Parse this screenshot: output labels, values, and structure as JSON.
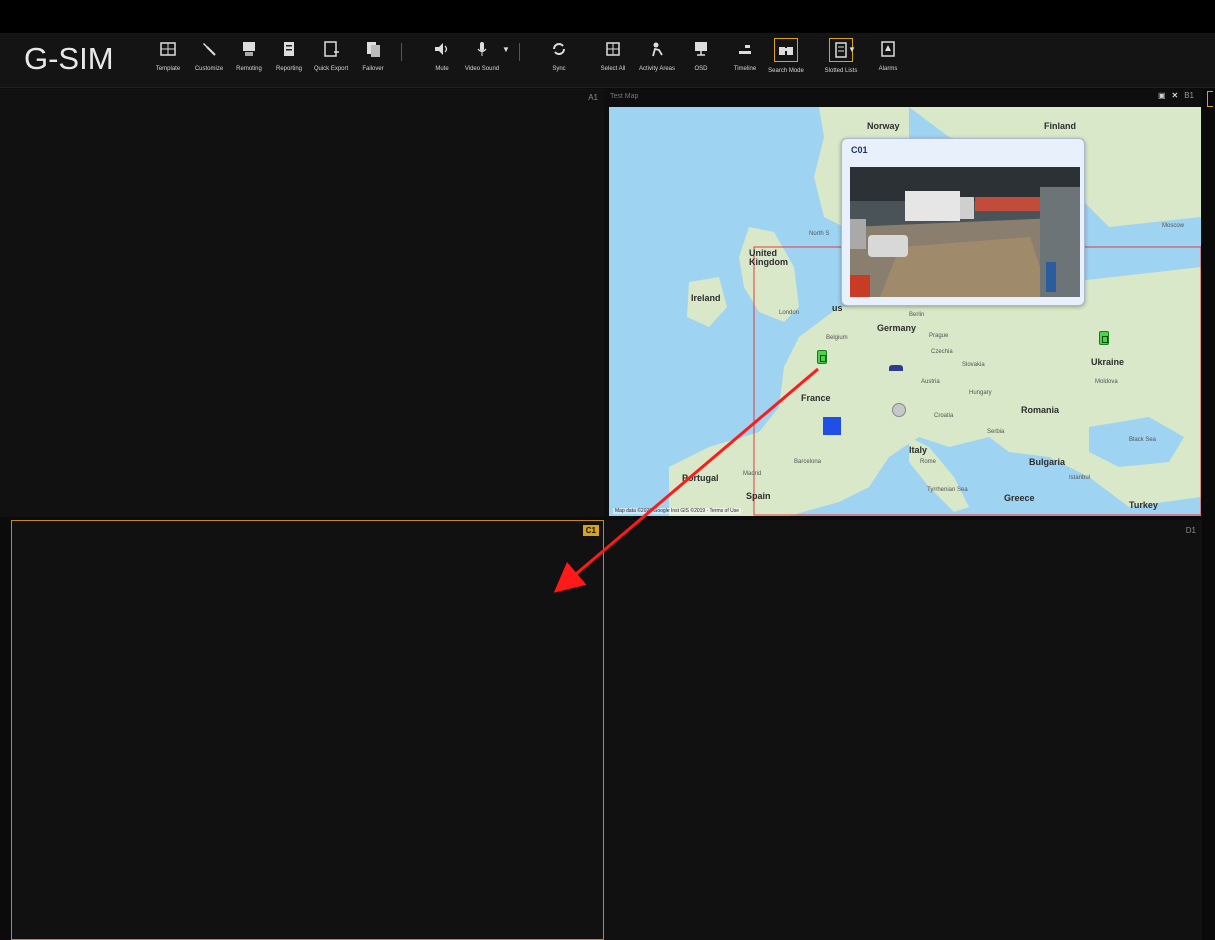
{
  "app": {
    "logo": "G-SIM"
  },
  "toolbar": {
    "items": [
      {
        "label": "Template",
        "icon": "template-icon"
      },
      {
        "label": "Customize",
        "icon": "wrench-icon"
      },
      {
        "label": "Remoting",
        "icon": "remoting-icon"
      },
      {
        "label": "Reporting",
        "icon": "reporting-icon"
      },
      {
        "label": "Quick Export",
        "icon": "export-icon"
      },
      {
        "label": "Failover",
        "icon": "failover-icon"
      },
      {
        "label": "Mute",
        "icon": "speaker-icon"
      },
      {
        "label": "Video Sound",
        "icon": "microphone-icon"
      },
      {
        "label": "Sync",
        "icon": "sync-icon"
      },
      {
        "label": "Select All",
        "icon": "grid-icon"
      },
      {
        "label": "Activity Areas",
        "icon": "activity-icon"
      },
      {
        "label": "OSD",
        "icon": "monitor-icon"
      },
      {
        "label": "Timeline",
        "icon": "timeline-icon"
      },
      {
        "label": "Search Mode",
        "icon": "binoculars-icon"
      },
      {
        "label": "Slotted Lists",
        "icon": "list-icon"
      },
      {
        "label": "Alarms",
        "icon": "alarm-icon"
      }
    ]
  },
  "panes": {
    "a1": {
      "label": "A1"
    },
    "b1": {
      "label": "B1",
      "title": "Test Map"
    },
    "c1": {
      "label": "C1"
    },
    "d1": {
      "label": "D1"
    }
  },
  "map": {
    "popup_title": "C01",
    "credit": "Map data ©2020 Google Inst GIS ©2019 - Terms of Use",
    "places": {
      "norway": "Norway",
      "finland": "Finland",
      "north": "North S",
      "uk": "United Kingdom",
      "ireland": "Ireland",
      "london": "London",
      "belgium": "Belgium",
      "germany": "Germany",
      "prague": "Prague",
      "czechia": "Czechia",
      "slovakia": "Slovakia",
      "ukraine": "Ukraine",
      "moldova": "Moldova",
      "austria": "Austria",
      "hungary": "Hungary",
      "france": "France",
      "romania": "Romania",
      "croatia": "Croatia",
      "serbia": "Serbia",
      "italy": "Italy",
      "rome": "Rome",
      "bulgaria": "Bulgaria",
      "barcelona": "Barcelona",
      "portugal": "Portugal",
      "madrid": "Madrid",
      "spain": "Spain",
      "greece": "Greece",
      "turkey": "Turkey",
      "black_sea": "Black Sea",
      "tyrrhenian": "Tyrrhenian Sea",
      "istanbul": "Istanbul",
      "moscow": "Moscow",
      "berlin": "Berlin",
      "us": "us"
    }
  },
  "colors": {
    "accent": "#d9a21b",
    "selected_border": "#c9861d",
    "arrow": "#ff1a1a",
    "camera_green": "#4ed34e",
    "map_water": "#9fd3f2",
    "map_land": "#d9e8c8"
  }
}
